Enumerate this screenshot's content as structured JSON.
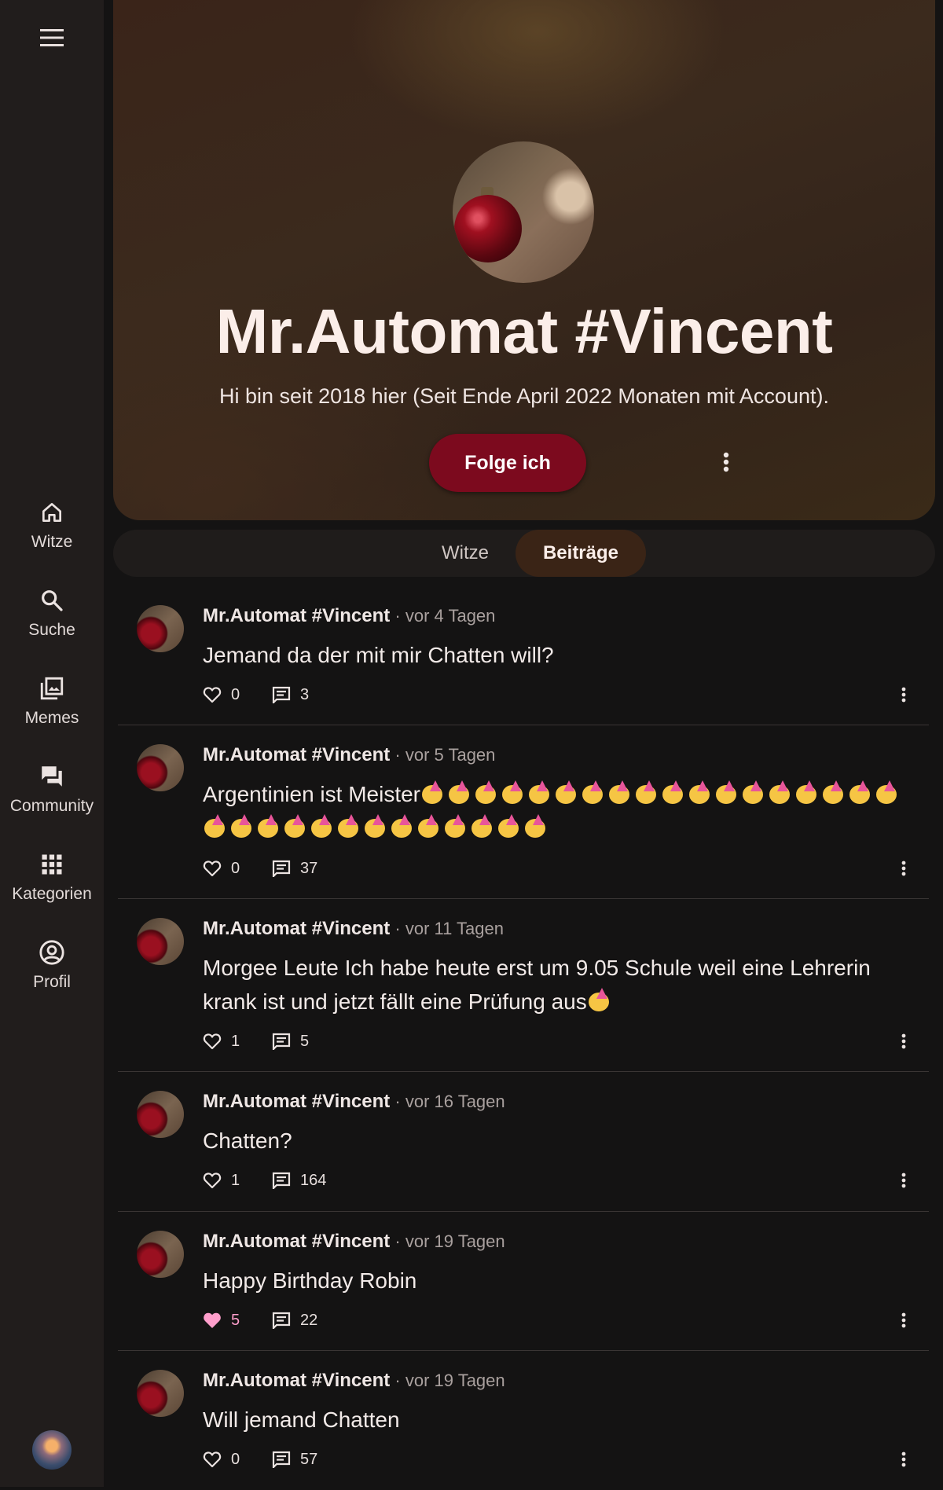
{
  "sidebar": {
    "menu_icon": "menu-icon",
    "items": [
      {
        "label": "Witze",
        "icon": "home-icon"
      },
      {
        "label": "Suche",
        "icon": "search-icon"
      },
      {
        "label": "Memes",
        "icon": "image-gallery-icon"
      },
      {
        "label": "Community",
        "icon": "forum-icon"
      },
      {
        "label": "Kategorien",
        "icon": "apps-grid-icon"
      },
      {
        "label": "Profil",
        "icon": "account-circle-icon"
      }
    ]
  },
  "profile": {
    "name": "Mr.Automat #Vincent",
    "bio": "Hi bin seit 2018 hier (Seit Ende April 2022 Monaten mit Account).",
    "follow_label": "Folge ich"
  },
  "tabs": [
    {
      "label": "Witze",
      "active": false
    },
    {
      "label": "Beiträge",
      "active": true
    }
  ],
  "posts": [
    {
      "author": "Mr.Automat #Vincent",
      "time": "vor 4 Tagen",
      "text": "Jemand da der mit mir Chatten will?",
      "emoji_count": 0,
      "likes": "0",
      "comments": "3",
      "liked": false
    },
    {
      "author": "Mr.Automat #Vincent",
      "time": "vor 5 Tagen",
      "text": "Argentinien ist Meister",
      "emoji_count": 31,
      "likes": "0",
      "comments": "37",
      "liked": false
    },
    {
      "author": "Mr.Automat #Vincent",
      "time": "vor 11 Tagen",
      "text": "Morgee Leute Ich habe heute erst um 9.05 Schule weil eine Lehrerin krank ist und jetzt fällt eine Prüfung aus",
      "emoji_count": 1,
      "likes": "1",
      "comments": "5",
      "liked": false
    },
    {
      "author": "Mr.Automat #Vincent",
      "time": "vor 16 Tagen",
      "text": "Chatten?",
      "emoji_count": 0,
      "likes": "1",
      "comments": "164",
      "liked": false
    },
    {
      "author": "Mr.Automat #Vincent",
      "time": "vor 19 Tagen",
      "text": "Happy Birthday Robin",
      "emoji_count": 0,
      "likes": "5",
      "comments": "22",
      "liked": true
    },
    {
      "author": "Mr.Automat #Vincent",
      "time": "vor 19 Tagen",
      "text": "Will jemand Chatten",
      "emoji_count": 0,
      "likes": "0",
      "comments": "57",
      "liked": false
    }
  ],
  "colors": {
    "follow_button": "#7c0a1e",
    "active_tab": "#3a2416",
    "liked": "#ff9ecb"
  }
}
